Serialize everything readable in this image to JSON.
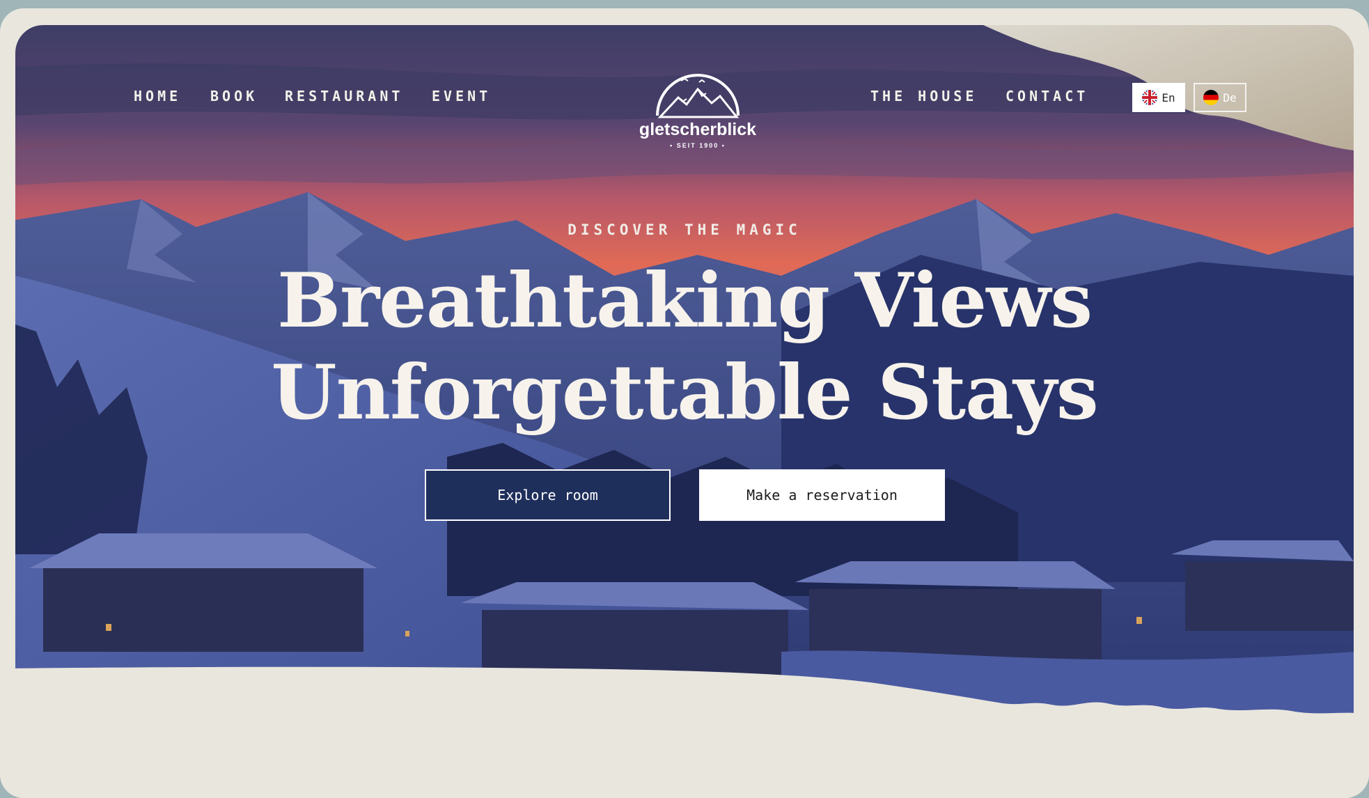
{
  "nav": {
    "left": [
      "HOME",
      "BOOK",
      "RESTAURANT",
      "EVENT"
    ],
    "right": [
      "THE HOUSE",
      "CONTACT"
    ]
  },
  "logo": {
    "name": "gletscherblick",
    "sub": "• SEIT 1900 •"
  },
  "languages": [
    {
      "label": "En",
      "flag": "uk-flag-icon",
      "active": true
    },
    {
      "label": "De",
      "flag": "germany-flag-icon",
      "active": false
    }
  ],
  "hero": {
    "eyebrow": "DISCOVER THE MAGIC",
    "headline_line1": "Breathtaking Views",
    "headline_line2": "Unforgettable Stays"
  },
  "buttons": {
    "explore": "Explore room",
    "reserve": "Make a reservation"
  },
  "colors": {
    "sky_top": "#4b3f6b",
    "sunset": "#e06a55",
    "mountain": "#2b3a72",
    "snow": "#5f6fb0",
    "paper": "#e9e6de",
    "outer": "#9fb5b8"
  }
}
